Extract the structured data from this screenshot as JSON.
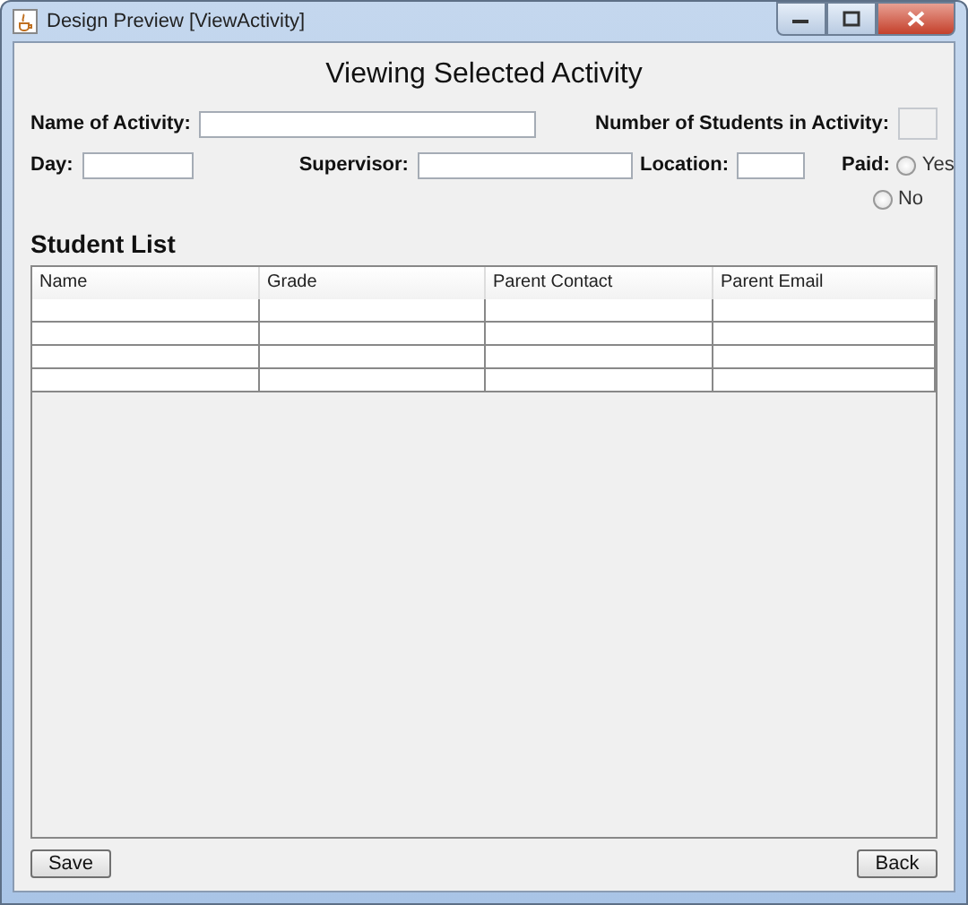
{
  "window": {
    "title": "Design Preview [ViewActivity]"
  },
  "heading": "Viewing Selected Activity",
  "fields": [
    {
      "label": "Name of Activity:",
      "disabled": false
    },
    {
      "label": "Number of Students in Activity:",
      "disabled": true
    },
    {
      "label": "Day:",
      "disabled": false
    },
    {
      "label": "Supervisor:",
      "disabled": false
    },
    {
      "label": "Location:",
      "disabled": false
    }
  ],
  "paid": {
    "label": "Paid:",
    "options": [
      {
        "label": "Yes",
        "selected": false
      },
      {
        "label": "No",
        "selected": false
      }
    ]
  },
  "section_title": "Student List",
  "table": {
    "columns": [
      "Name",
      "Grade",
      "Parent Contact",
      "Parent Email"
    ],
    "rows": [
      {
        "selected": false
      },
      {
        "selected": false
      },
      {
        "selected": false
      },
      {
        "selected": false
      }
    ]
  },
  "buttons": [
    "Save",
    "Back"
  ]
}
